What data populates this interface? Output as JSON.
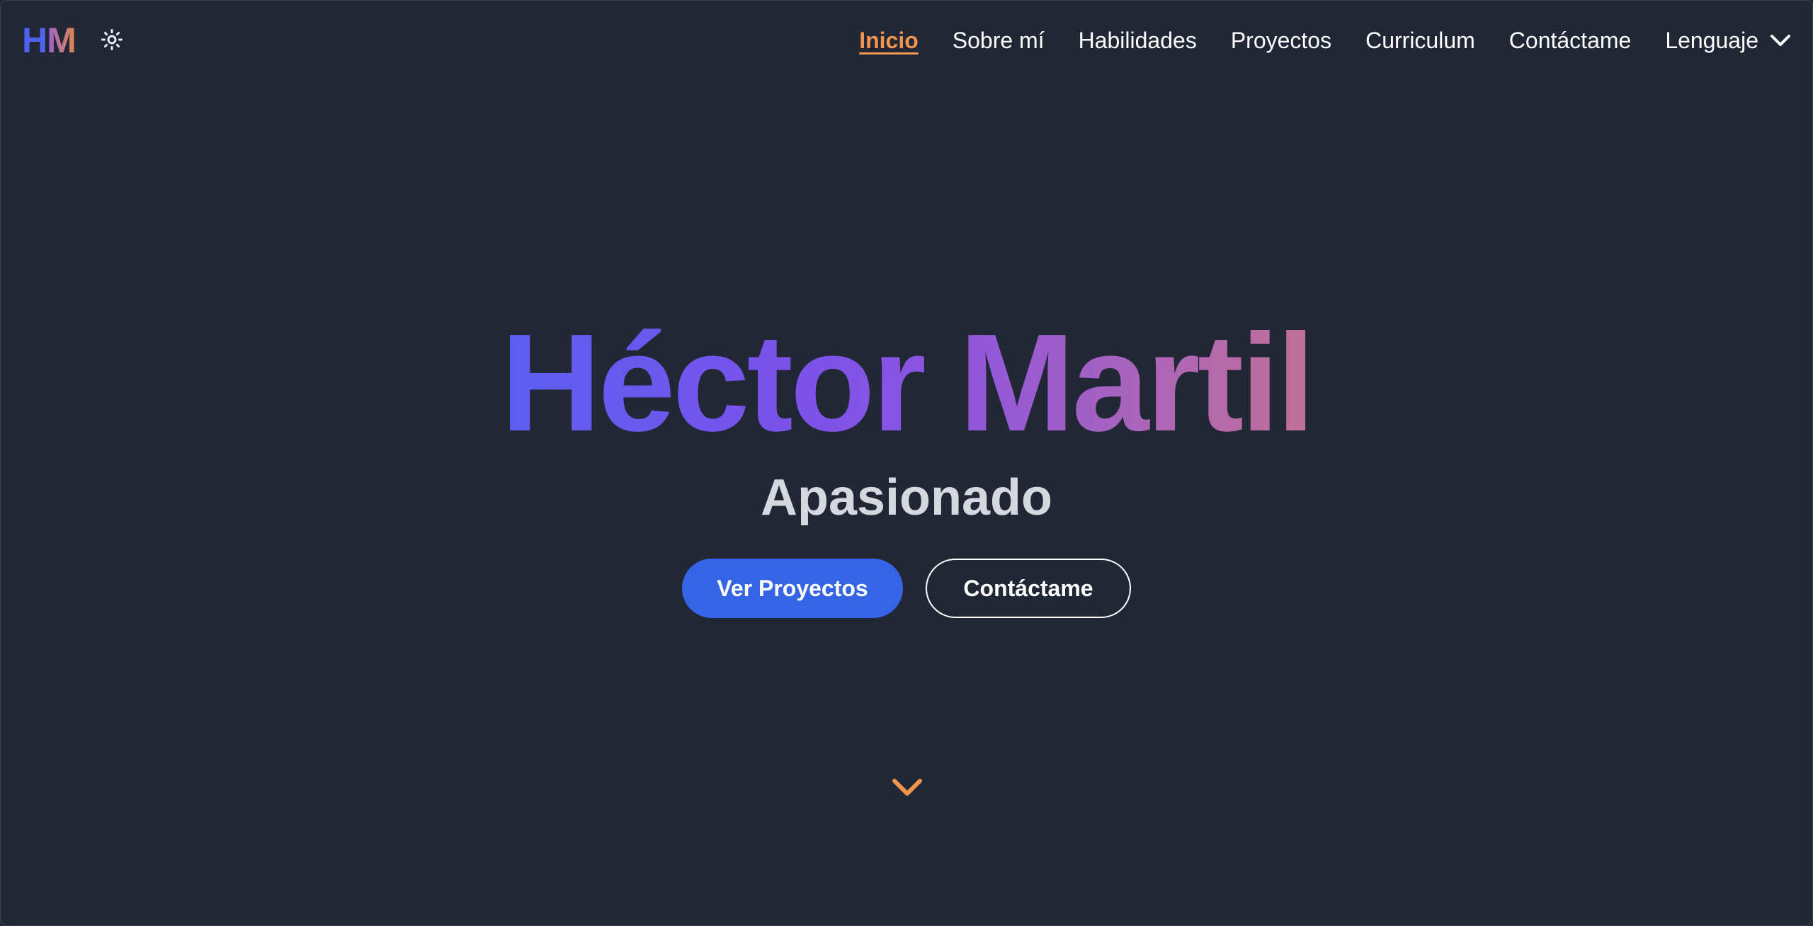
{
  "logo": {
    "h": "H",
    "m": "M"
  },
  "theme_toggle": {
    "icon": "sun-icon"
  },
  "nav": {
    "items": [
      {
        "label": "Inicio",
        "active": true
      },
      {
        "label": "Sobre mí"
      },
      {
        "label": "Habilidades"
      },
      {
        "label": "Proyectos"
      },
      {
        "label": "Curriculum"
      },
      {
        "label": "Contáctame"
      }
    ],
    "language_label": "Lenguaje",
    "language_icon": "chevron-down-icon"
  },
  "hero": {
    "name": "Héctor Martil",
    "subtitle": "Apasionado",
    "primary_button": "Ver Proyectos",
    "secondary_button": "Contáctame",
    "scroll_icon": "chevron-down-icon"
  },
  "colors": {
    "background": "#212735",
    "accent_orange": "#f0954e",
    "primary_blue": "#3565e6",
    "gradient_start": "#5b5ef2",
    "gradient_end": "#c07096"
  }
}
